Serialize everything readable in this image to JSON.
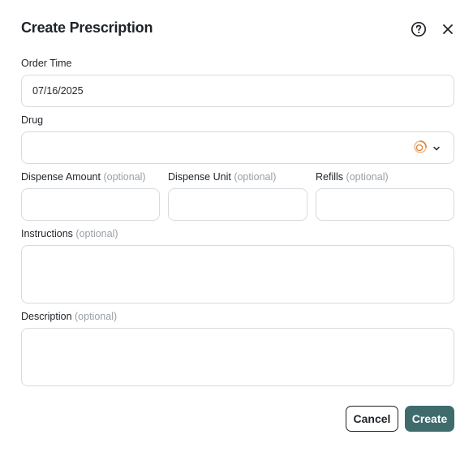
{
  "dialog": {
    "title": "Create Prescription",
    "help_icon": "question-circle-icon",
    "close_icon": "close-icon"
  },
  "fields": {
    "order_time": {
      "label": "Order Time",
      "value": "07/16/2025"
    },
    "drug": {
      "label": "Drug",
      "value": "",
      "loading_icon": "spinner-icon",
      "dropdown_icon": "chevron-down-icon"
    },
    "dispense_amount": {
      "label": "Dispense Amount",
      "optional": "(optional)",
      "value": ""
    },
    "dispense_unit": {
      "label": "Dispense Unit",
      "optional": "(optional)",
      "value": ""
    },
    "refills": {
      "label": "Refills",
      "optional": "(optional)",
      "value": ""
    },
    "instructions": {
      "label": "Instructions",
      "optional": "(optional)",
      "value": ""
    },
    "description": {
      "label": "Description",
      "optional": "(optional)",
      "value": ""
    }
  },
  "actions": {
    "cancel_label": "Cancel",
    "create_label": "Create"
  },
  "colors": {
    "primary": "#3f6b6d",
    "border": "#d7dadd",
    "muted_text": "#9aa0a6",
    "spinner": "#e08a3c"
  }
}
